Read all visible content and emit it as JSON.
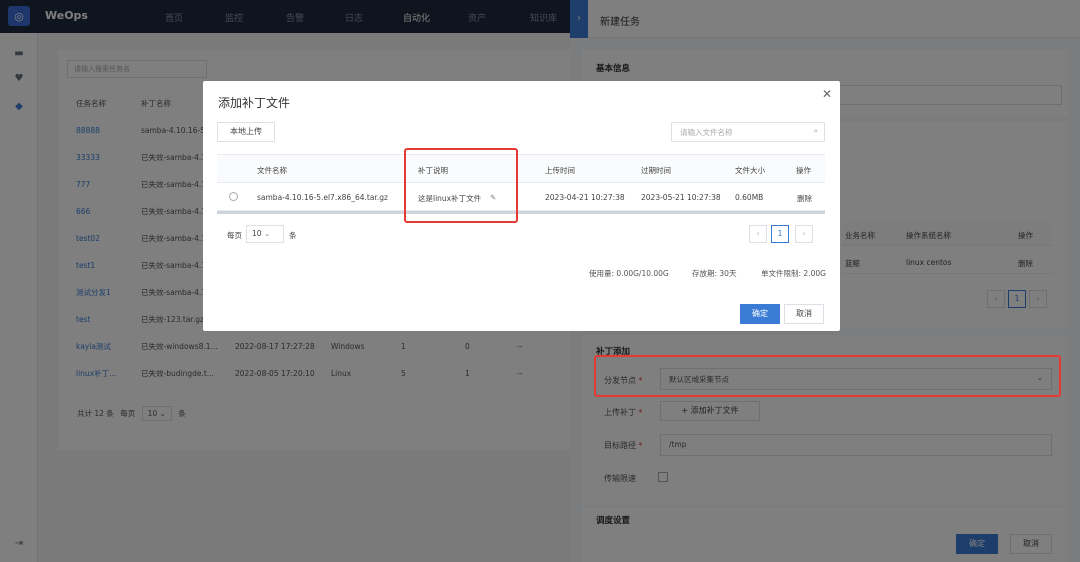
{
  "app": {
    "brand": "WeOps",
    "logo_icon": "owl-logo-icon"
  },
  "topnav": [
    "首页",
    "监控",
    "告警",
    "日志",
    "自动化",
    "资产",
    "知识库"
  ],
  "background": {
    "search_placeholder": "请输入搜索任务名",
    "columns": [
      "任务名称",
      "补丁名称"
    ],
    "rows": [
      {
        "name": "88888",
        "patch": "samba-4.10.16-5"
      },
      {
        "name": "33333",
        "patch": "已失效-samba-4.1"
      },
      {
        "name": "777",
        "patch": "已失效-samba-4.1"
      },
      {
        "name": "666",
        "patch": "已失效-samba-4.1"
      },
      {
        "name": "test02",
        "patch": "已失效-samba-4.1"
      },
      {
        "name": "test1",
        "patch": "已失效-samba-4.1"
      },
      {
        "name": "测试分发1",
        "patch": "已失效-samba-4.1"
      },
      {
        "name": "test",
        "patch": "已失效-123.tar.gz"
      },
      {
        "name": "kayla测试",
        "patch": "已失效-windows8.1...",
        "time": "2022-08-17 17:27:28",
        "os": "Windows",
        "a": "1",
        "b": "0",
        "c": "--"
      },
      {
        "name": "linux补丁...",
        "patch": "已失效-budingde.t...",
        "time": "2022-08-05 17:20:10",
        "os": "Linux",
        "a": "5",
        "b": "1",
        "c": "--"
      }
    ],
    "total_text": "共计 12 条",
    "per_page_label": "每页",
    "per_page_value": "10",
    "per_page_unit": "条"
  },
  "drawer": {
    "title": "新建任务",
    "basic_info": "基本信息",
    "host_columns": [
      "业务名称",
      "操作系统名称",
      "操作"
    ],
    "host_row": {
      "biz": "蓝鲸",
      "os": "linux centos",
      "action": "删除"
    },
    "patch_section": "补丁添加",
    "node_label": "分发节点",
    "node_value": "默认区域采集节点",
    "upload_label": "上传补丁",
    "upload_button": "+ 添加补丁文件",
    "target_label": "目标路径",
    "target_value": "/tmp",
    "speed_label": "传输限速",
    "schedule_section": "调度设置",
    "confirm": "确定",
    "cancel": "取消"
  },
  "modal": {
    "title": "添加补丁文件",
    "local_upload": "本地上传",
    "search_placeholder": "请输入文件名称",
    "columns": [
      "文件名称",
      "补丁说明",
      "上传时间",
      "过期时间",
      "文件大小",
      "操作"
    ],
    "row": {
      "file": "samba-4.10.16-5.el7.x86_64.tar.gz",
      "desc": "这是linux补丁文件",
      "upload_time": "2023-04-21 10:27:38",
      "expire_time": "2023-05-21 10:27:38",
      "size": "0.60MB",
      "action": "删除"
    },
    "per_page_label": "每页",
    "per_page_value": "10",
    "per_page_unit": "条",
    "page": "1",
    "usage": "使用量: 0.00G/10.00G",
    "retention": "存放期: 30天",
    "limit": "单文件限制: 2.00G",
    "confirm": "确定",
    "cancel": "取消"
  },
  "highlight_color": "#e53935",
  "accent_color": "#3a7bd5"
}
